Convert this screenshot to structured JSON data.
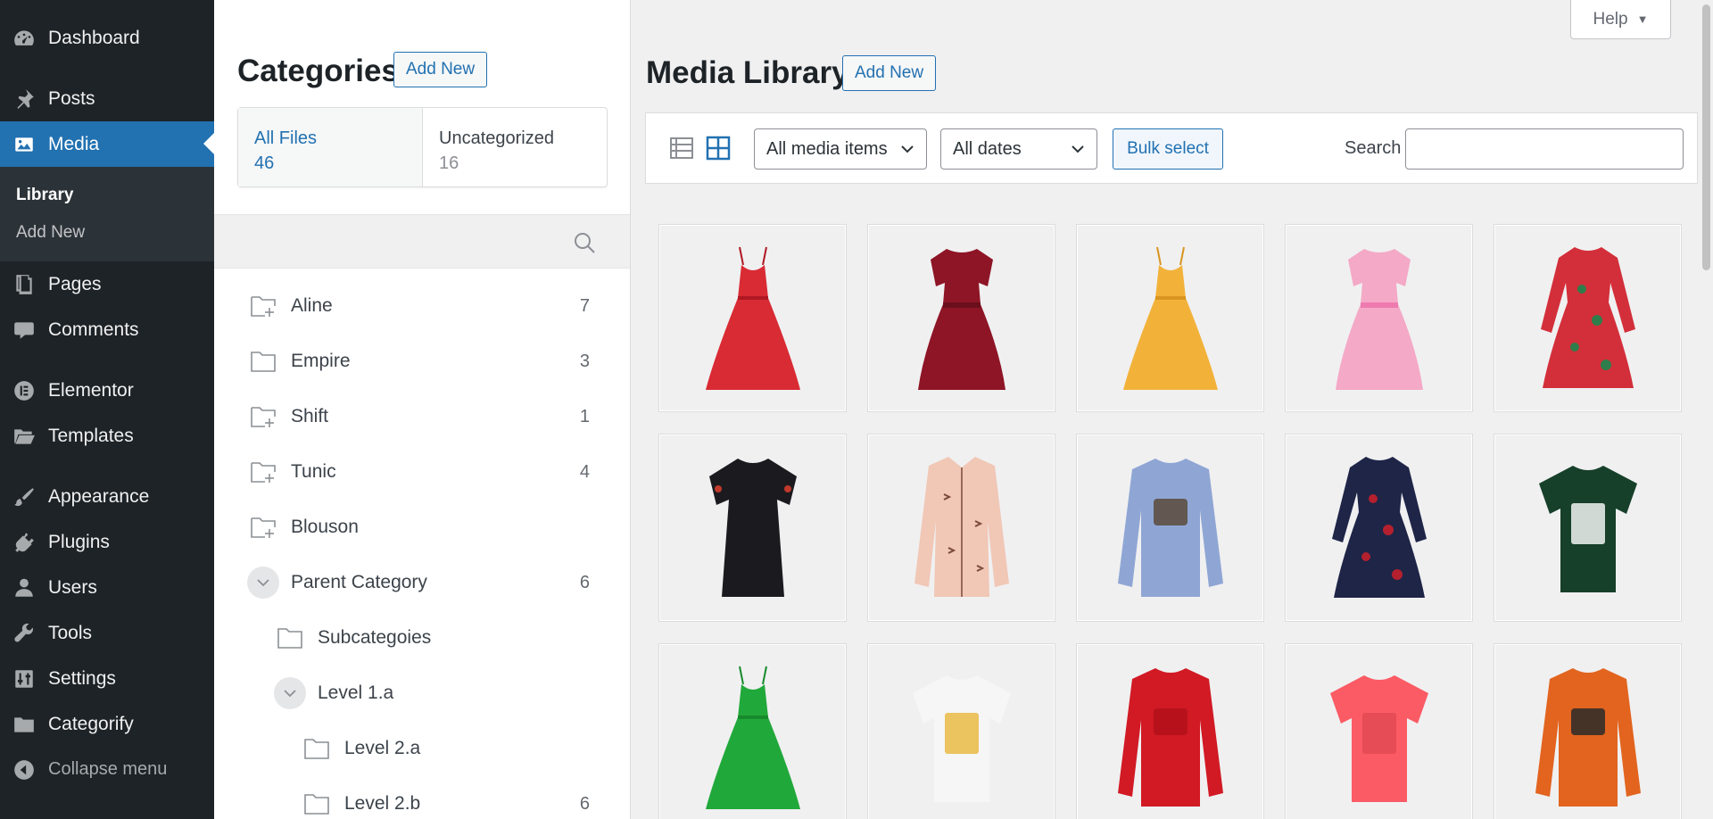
{
  "sidebar": {
    "items": [
      {
        "label": "Dashboard",
        "icon": "dashboard-icon"
      },
      {
        "label": "Posts",
        "icon": "pushpin-icon"
      },
      {
        "label": "Media",
        "icon": "media-icon",
        "current": true
      },
      {
        "label": "Pages",
        "icon": "pages-icon"
      },
      {
        "label": "Comments",
        "icon": "comment-icon"
      },
      {
        "label": "Elementor",
        "icon": "elementor-icon"
      },
      {
        "label": "Templates",
        "icon": "folder-open-icon"
      },
      {
        "label": "Appearance",
        "icon": "paintbrush-icon"
      },
      {
        "label": "Plugins",
        "icon": "plug-icon"
      },
      {
        "label": "Users",
        "icon": "user-icon"
      },
      {
        "label": "Tools",
        "icon": "wrench-icon"
      },
      {
        "label": "Settings",
        "icon": "settings-icon"
      },
      {
        "label": "Categorify",
        "icon": "folder-icon"
      }
    ],
    "submenu": [
      {
        "label": "Library",
        "current": true
      },
      {
        "label": "Add New"
      }
    ],
    "collapse_label": "Collapse menu"
  },
  "categories": {
    "title": "Categories",
    "add_new_label": "Add New",
    "all_files": {
      "label": "All Files",
      "count": "46"
    },
    "uncategorized": {
      "label": "Uncategorized",
      "count": "16"
    },
    "list": [
      {
        "name": "Aline",
        "count": "7",
        "icon": "folder-plus-icon"
      },
      {
        "name": "Empire",
        "count": "3",
        "icon": "folder-icon"
      },
      {
        "name": "Shift",
        "count": "1",
        "icon": "folder-plus-icon"
      },
      {
        "name": "Tunic",
        "count": "4",
        "icon": "folder-plus-icon"
      },
      {
        "name": "Blouson",
        "count": "",
        "icon": "folder-plus-icon"
      },
      {
        "name": "Parent Category",
        "count": "6",
        "icon": "chevron-down-icon"
      },
      {
        "name": "Subcategoies",
        "count": "",
        "icon": "folder-icon"
      },
      {
        "name": "Level 1.a",
        "count": "",
        "icon": "chevron-down-icon"
      },
      {
        "name": "Level 2.a",
        "count": "",
        "icon": "folder-icon"
      },
      {
        "name": "Level 2.b",
        "count": "6",
        "icon": "folder-icon"
      }
    ]
  },
  "media": {
    "title": "Media Library",
    "add_new_label": "Add New",
    "help_label": "Help",
    "filter_type": "All media items",
    "filter_date": "All dates",
    "bulk_select_label": "Bulk select",
    "search_label": "Search",
    "search_value": "",
    "items": [
      {
        "name": "red lace slip dress",
        "kind": "dress",
        "color": "#d92b34",
        "accent": "#b01822"
      },
      {
        "name": "burgundy lace midi dress",
        "kind": "dress-sleeve",
        "color": "#8e1526",
        "accent": "#6b0f1c"
      },
      {
        "name": "yellow flared dress",
        "kind": "dress",
        "color": "#f2b23a",
        "accent": "#d99520"
      },
      {
        "name": "pink tutu dress",
        "kind": "dress-sleeve",
        "color": "#f4a9c6",
        "accent": "#ee7ab0"
      },
      {
        "name": "red floral print dress",
        "kind": "dress-long",
        "color": "#d32f3a",
        "accent": "#2e7d4a"
      },
      {
        "name": "black embroidered shift dress",
        "kind": "tee-dress",
        "color": "#1b1b1f",
        "accent": "#c0392b"
      },
      {
        "name": "pink bird print shirt",
        "kind": "shirt",
        "color": "#f1c7b6",
        "accent": "#7a4a3a"
      },
      {
        "name": "blue long sleeve eagle tee",
        "kind": "longsleeve",
        "color": "#8fa6d4",
        "accent": "#5a4a3a"
      },
      {
        "name": "navy embroidered dress",
        "kind": "dress-long",
        "color": "#1e2547",
        "accent": "#b4202e"
      },
      {
        "name": "green best dog mom tee",
        "kind": "tee",
        "color": "#16402a",
        "accent": "#ffffff"
      },
      {
        "name": "green maxi dress",
        "kind": "dress",
        "color": "#21a83a",
        "accent": "#178a2c"
      },
      {
        "name": "white graphic tee",
        "kind": "tee",
        "color": "#f6f6f6",
        "accent": "#e8b73a"
      },
      {
        "name": "red long sleeve tee",
        "kind": "longsleeve",
        "color": "#d11a24",
        "accent": "#b3121b"
      },
      {
        "name": "coral tee",
        "kind": "tee",
        "color": "#fb5b64",
        "accent": "#e14852"
      },
      {
        "name": "orange long sleeve car tee",
        "kind": "longsleeve",
        "color": "#e2641f",
        "accent": "#2a2a2a"
      }
    ]
  },
  "colors": {
    "sidebar_bg": "#1d2327",
    "accent": "#2271b1",
    "page_bg": "#f0f0f1"
  }
}
